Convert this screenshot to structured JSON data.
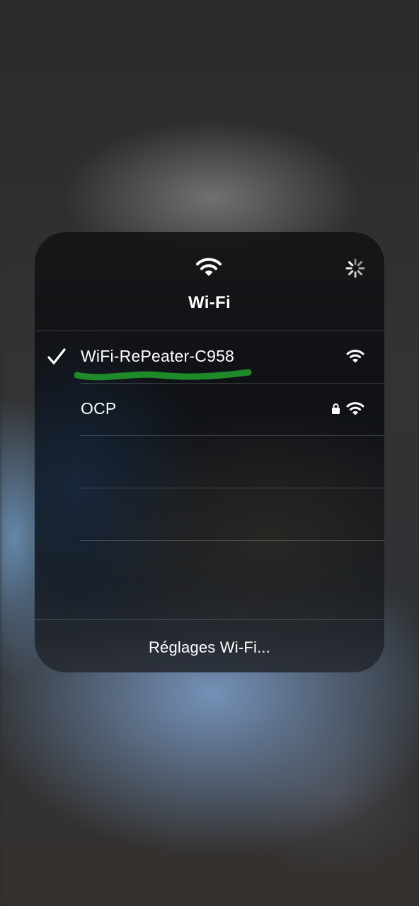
{
  "panel": {
    "title": "Wi-Fi",
    "header_icon": "wifi-icon",
    "loading_icon": "activity-spinner-icon"
  },
  "networks": [
    {
      "name": "WiFi-RePeater-C958",
      "connected": true,
      "secured": false,
      "icons": [
        "checkmark-icon",
        "wifi-signal-icon"
      ],
      "annotation_color": "#1f8a2a"
    },
    {
      "name": "OCP",
      "connected": false,
      "secured": true,
      "icons": [
        "lock-icon",
        "wifi-signal-icon"
      ]
    }
  ],
  "footer": {
    "settings_label": "Réglages Wi-Fi..."
  }
}
